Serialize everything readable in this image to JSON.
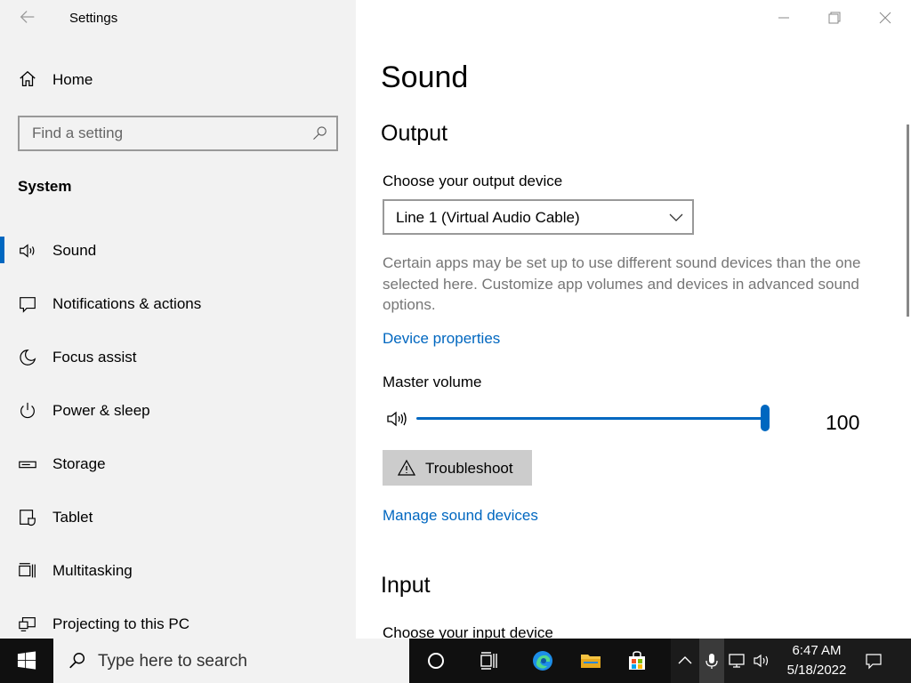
{
  "window": {
    "title": "Settings"
  },
  "sidebar": {
    "home_label": "Home",
    "search_placeholder": "Find a setting",
    "section_title": "System",
    "items": [
      {
        "label": "Sound",
        "icon": "speaker-icon",
        "active": true
      },
      {
        "label": "Notifications & actions",
        "icon": "notification-icon"
      },
      {
        "label": "Focus assist",
        "icon": "moon-icon"
      },
      {
        "label": "Power & sleep",
        "icon": "power-icon"
      },
      {
        "label": "Storage",
        "icon": "storage-icon"
      },
      {
        "label": "Tablet",
        "icon": "tablet-icon"
      },
      {
        "label": "Multitasking",
        "icon": "multitasking-icon"
      },
      {
        "label": "Projecting to this PC",
        "icon": "projecting-icon"
      }
    ]
  },
  "main": {
    "title": "Sound",
    "output": {
      "heading": "Output",
      "device_label": "Choose your output device",
      "device_value": "Line 1 (Virtual Audio Cable)",
      "description": "Certain apps may be set up to use different sound devices than the one selected here. Customize app volumes and devices in advanced sound options.",
      "device_properties_link": "Device properties",
      "master_volume_label": "Master volume",
      "volume_value": "100",
      "troubleshoot_label": "Troubleshoot",
      "manage_devices_link": "Manage sound devices"
    },
    "input": {
      "heading": "Input",
      "device_label": "Choose your input device"
    }
  },
  "taskbar": {
    "search_placeholder": "Type here to search",
    "time": "6:47 AM",
    "date": "5/18/2022"
  },
  "colors": {
    "accent": "#0067c0",
    "sidebar_bg": "#f2f2f2",
    "taskbar_bg": "#101010"
  }
}
